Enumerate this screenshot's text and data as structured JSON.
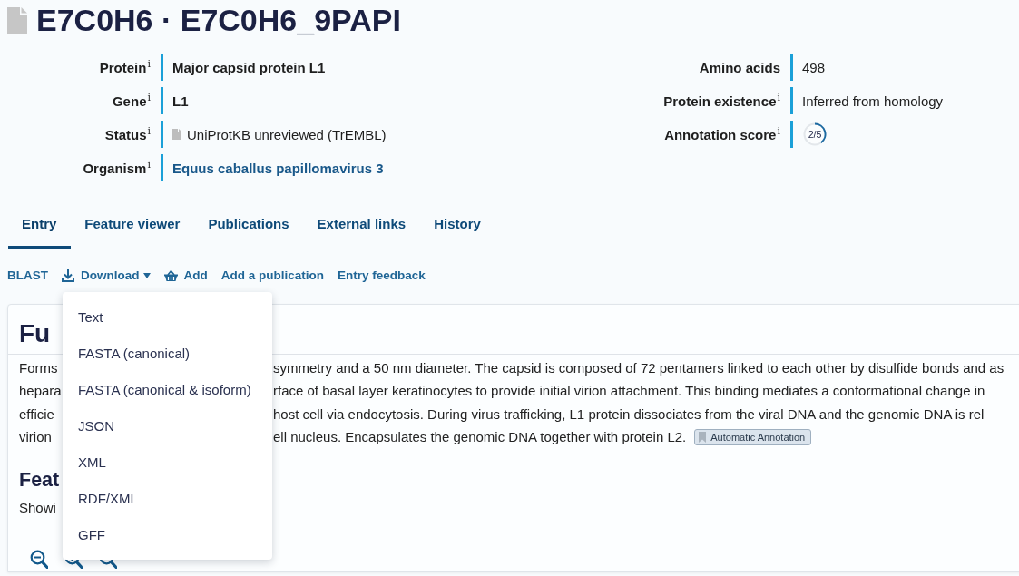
{
  "title": "E7C0H6 · E7C0H6_9PAPI",
  "summary": {
    "left": [
      {
        "label": "Protein$^{i}$",
        "kind": "strong",
        "value": "Major capsid protein L1"
      },
      {
        "label": "Gene$^{i}$",
        "kind": "strong",
        "value": "L1"
      },
      {
        "label": "Status$^{i}$",
        "kind": "status",
        "value": "UniProtKB unreviewed (TrEMBL)"
      },
      {
        "label": "Organism$^{i}$",
        "kind": "link",
        "value": "Equus caballus papillomavirus 3"
      }
    ],
    "right": [
      {
        "label": "Amino acids",
        "kind": "plain",
        "value": "498"
      },
      {
        "label": "Protein existence$^{i}$",
        "kind": "plain",
        "value": "Inferred from homology"
      },
      {
        "label": "Annotation score$^{i}$",
        "kind": "score",
        "value": "2/5",
        "level": 0.4
      }
    ]
  },
  "tabs": [
    {
      "label": "Entry",
      "selected": true
    },
    {
      "label": "Feature viewer",
      "selected": false
    },
    {
      "label": "Publications",
      "selected": false
    },
    {
      "label": "External links",
      "selected": false
    },
    {
      "label": "History",
      "selected": false
    }
  ],
  "actions": [
    {
      "kind": "link",
      "label": "BLAST"
    },
    {
      "kind": "dropdown",
      "label": "Download",
      "expanded": true,
      "items": [
        "Text",
        "FASTA (canonical)",
        "FASTA (canonical & isoform)",
        "JSON",
        "XML",
        "RDF/XML",
        "GFF"
      ]
    },
    {
      "kind": "cart",
      "label": "Add"
    },
    {
      "kind": "link",
      "label": "Add a publication"
    },
    {
      "kind": "link",
      "label": "Entry feedback"
    }
  ],
  "function_section": {
    "heading": "Fu",
    "lines": [
      {
        "left": "Forms",
        "right": "symmetry and a 50 nm diameter. The capsid is composed of 72 pentamers linked to each other by disulfide bonds and as"
      },
      {
        "left": "hepara",
        "right": "rface of basal layer keratinocytes to provide initial virion attachment. This binding mediates a conformational change in"
      },
      {
        "left": "efficie",
        "right": "host cell via endocytosis. During virus trafficking, L1 protein dissociates from the viral DNA and the genomic DNA is rel"
      },
      {
        "left": "virion",
        "right": "ell nucleus. Encapsulates the genomic DNA together with protein L2.",
        "badge": "Automatic Annotation"
      }
    ]
  },
  "features_section": {
    "heading": "Feat",
    "text": "Showi"
  }
}
